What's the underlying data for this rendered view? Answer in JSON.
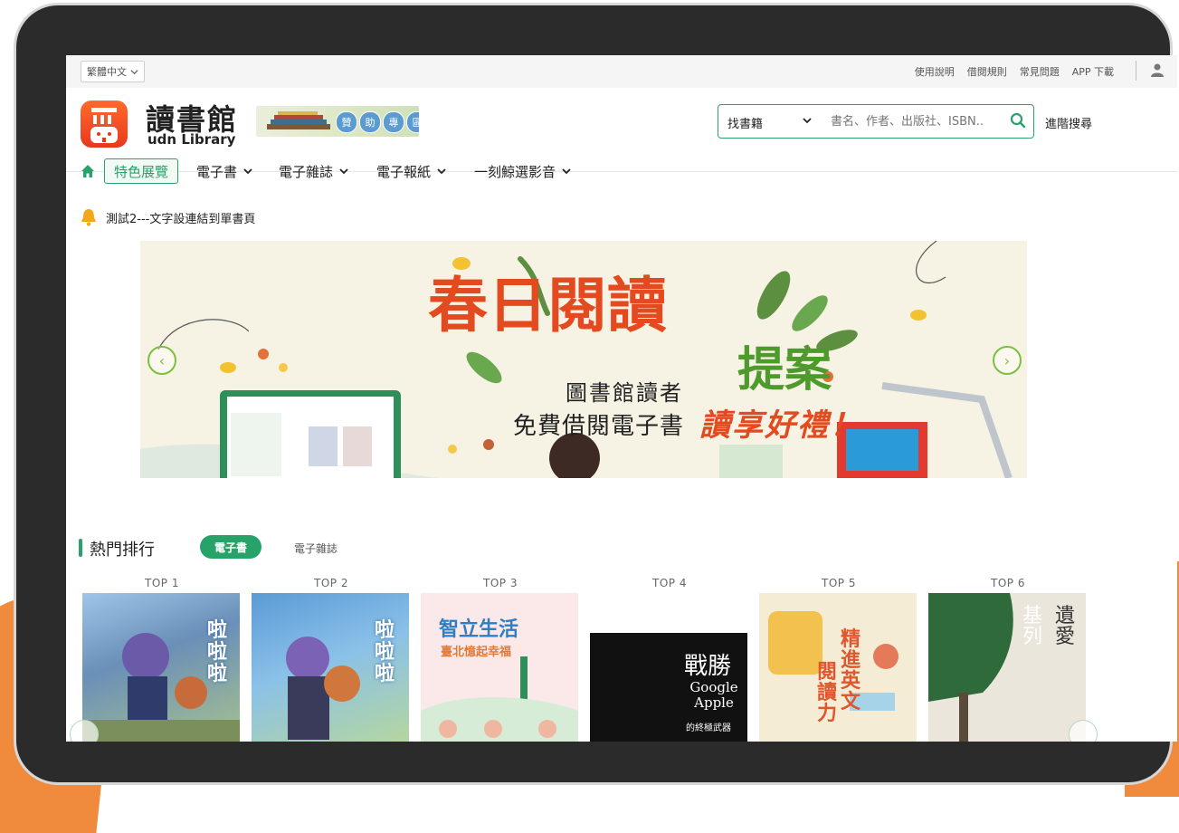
{
  "utilbar": {
    "language": "繁體中文",
    "links": [
      "使用說明",
      "借閱規則",
      "常見問題",
      "APP 下載"
    ]
  },
  "header": {
    "logo_main": "讀書館",
    "logo_sub": "udn Library",
    "logo_icon_text": "iii",
    "sponsor_chars": [
      "贊",
      "助",
      "專",
      "區"
    ],
    "search_scope": "找書籍",
    "search_placeholder": "書名、作者、出版社、ISBN..",
    "advanced_search": "進階搜尋"
  },
  "nav": {
    "featured": "特色展覽",
    "items": [
      "電子書",
      "電子雜誌",
      "電子報紙",
      "一刻鯨選影音"
    ]
  },
  "announcement": "測試2---文字設連結到單書頁",
  "hero": {
    "title": "春日閱讀",
    "title_suffix": "提案",
    "line1": "圖書館讀者",
    "line2": "免費借閱電子書",
    "line2_accent": "讀享好禮！"
  },
  "ranking": {
    "title": "熱門排行",
    "tabs": [
      "電子書",
      "電子雜誌"
    ],
    "items": [
      {
        "rank": "TOP 1",
        "cover_text": "啦啦啦"
      },
      {
        "rank": "TOP 2",
        "cover_text": "啦啦啦"
      },
      {
        "rank": "TOP 3",
        "cover_text": "智立生活",
        "cover_sub": "臺北憶起幸福"
      },
      {
        "rank": "TOP 4",
        "cover_text": "戰勝",
        "cover_sub": "Google Apple",
        "cover_sub2": "的終極武器"
      },
      {
        "rank": "TOP 5",
        "cover_text": "精進英文",
        "cover_sub": "閱讀力"
      },
      {
        "rank": "TOP 6",
        "cover_text": "遺愛",
        "cover_sub": "基列"
      }
    ]
  },
  "colors": {
    "brand_green": "#27a36a",
    "logo_orange": "#ff6a2c",
    "frame": "#2b2b2b",
    "accent_red": "#e34a1f"
  },
  "icons": [
    "chevron-down-icon",
    "user-icon",
    "search-icon",
    "home-icon",
    "bell-icon",
    "arrow-left-icon",
    "arrow-right-icon"
  ]
}
